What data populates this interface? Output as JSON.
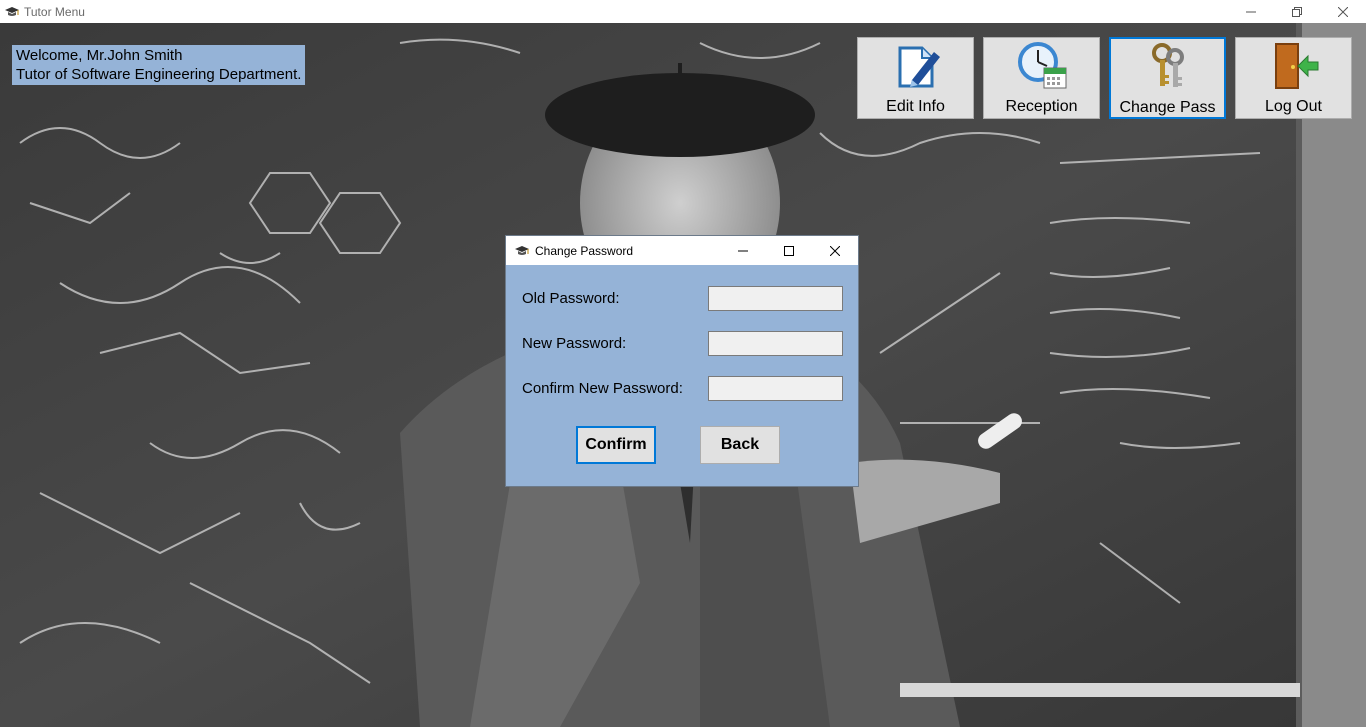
{
  "window": {
    "title": "Tutor Menu",
    "controls": {
      "minimize": "—",
      "maximize": "❐",
      "close": "✕"
    }
  },
  "welcome": {
    "line1": "Welcome, Mr.John Smith",
    "line2": "Tutor of Software Engineering Department."
  },
  "toolbar": {
    "buttons": [
      {
        "label": "Edit Info",
        "icon": "edit-document-icon"
      },
      {
        "label": "Reception",
        "icon": "clock-calendar-icon"
      },
      {
        "label": "Change Pass",
        "icon": "keys-icon"
      },
      {
        "label": "Log Out",
        "icon": "exit-door-icon"
      }
    ]
  },
  "dialog": {
    "title": "Change Password",
    "controls": {
      "minimize": "—",
      "maximize": "☐",
      "close": "✕"
    },
    "old_label": "Old Password:",
    "new_label": "New Password:",
    "confirm_label": "Confirm New Password:",
    "old_value": "",
    "new_value": "",
    "confirm_value": "",
    "confirm_button": "Confirm",
    "back_button": "Back"
  },
  "colors": {
    "accent": "#0078d7",
    "panel": "#95b3d7",
    "button": "#e1e1e1"
  }
}
